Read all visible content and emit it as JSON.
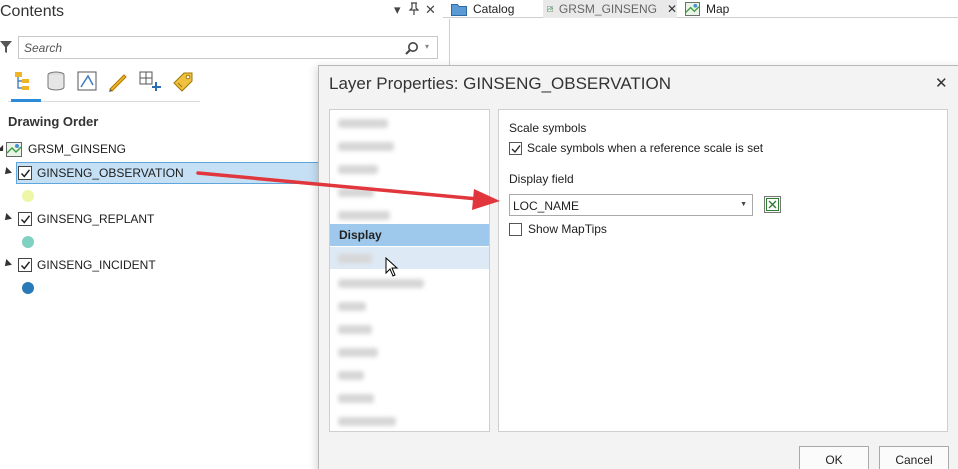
{
  "contents": {
    "title": "Contents",
    "search_placeholder": "Search",
    "drawing_order_label": "Drawing Order",
    "map_name": "GRSM_GINSENG",
    "layers": [
      {
        "name": "GINSENG_OBSERVATION",
        "checked": true,
        "selected": true,
        "symbol_color": "#eef7a8"
      },
      {
        "name": "GINSENG_REPLANT",
        "checked": true,
        "selected": false,
        "symbol_color": "#7fd1c2"
      },
      {
        "name": "GINSENG_INCIDENT",
        "checked": true,
        "selected": false,
        "symbol_color": "#2a7ab8"
      }
    ],
    "toolbar_icons": [
      "list-by-drawing-order-icon",
      "list-by-data-source-icon",
      "list-by-selection-icon",
      "list-by-editing-icon",
      "list-by-snapping-icon",
      "list-by-labeling-icon"
    ]
  },
  "tabs": [
    {
      "label": "Catalog",
      "icon": "catalog-icon",
      "active": false
    },
    {
      "label": "GRSM_GINSENG",
      "icon": "map-icon",
      "active": true,
      "closable": true
    },
    {
      "label": "Map",
      "icon": "map-icon",
      "active": false
    }
  ],
  "dialog": {
    "title": "Layer Properties: GINSENG_OBSERVATION",
    "nav_active_label": "Display",
    "scale_section_label": "Scale symbols",
    "scale_checkbox_label": "Scale symbols when a reference scale is set",
    "scale_checked": true,
    "display_field_label": "Display field",
    "display_field_value": "LOC_NAME",
    "show_maptips_label": "Show MapTips",
    "show_maptips_checked": false,
    "ok_label": "OK",
    "cancel_label": "Cancel"
  },
  "colors": {
    "selection_fill": "#c5e0f5",
    "nav_active": "#9fc9ec",
    "arrow": "#e0363c",
    "accent": "#2b8bd8"
  }
}
